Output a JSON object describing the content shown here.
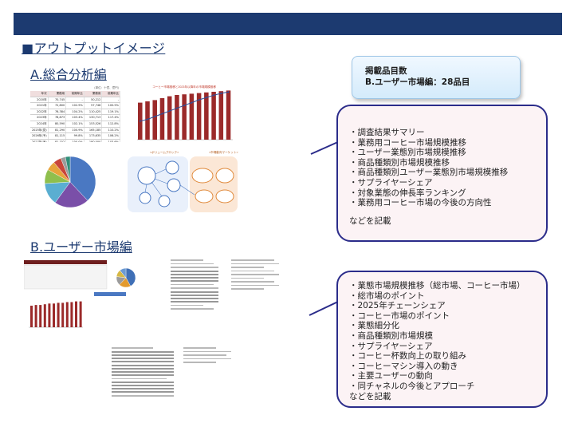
{
  "page": {
    "title": "■アウトプットイメージ",
    "section_a_title": "A.総合分析編",
    "section_b_title": "B.ユーザー市場編"
  },
  "count_box": {
    "line1": "掲載品目数",
    "line2": "B.ユーザー市場編：28品目"
  },
  "callout_a": {
    "items": [
      "・調査結果サマリー",
      "・業務用コーヒー市場規模推移",
      "・ユーザー業態別市場規模推移",
      "・商品種類別市場規模推移",
      "・商品種類別ユーザー業態別市場規模推移",
      "・サプライヤーシェア",
      "・対象業態の伸長率ランキング",
      "・業務用コーヒー市場の今後の方向性"
    ],
    "note": "などを記載"
  },
  "callout_b": {
    "items": [
      "・業態市場規模推移（総市場、コーヒー市場）",
      "・総市場のポイント",
      "・2025年チェーンシェア",
      "・コーヒー市場のポイント",
      "・業態細分化",
      "・商品種類別市場規模",
      "・サプライヤーシェア",
      "・コーヒー杯数向上の取り組み",
      "・コーヒーマシン導入の動き",
      "・主要ユーザーの動向",
      "・同チャネルの今後とアプローチ"
    ],
    "note": "などを記載"
  },
  "thumbnails": {
    "table_unit": "(単位：十億、億円)",
    "table_head": [
      "年次",
      "業務用",
      "前期年比",
      "業務用",
      "前期年比"
    ],
    "table_rows": [
      [
        "2020年",
        "70,745",
        "-",
        "50,212",
        "-"
      ],
      [
        "2021年",
        "72,800",
        "102.9%",
        "57,748",
        "100.5%"
      ],
      [
        "2022年",
        "76,384",
        "104.2%",
        "110,425",
        "119.1%"
      ],
      [
        "2023年",
        "78,873",
        "103.4%",
        "130,713",
        "117.4%"
      ],
      [
        "2024年",
        "80,590",
        "102.1%",
        "153,526",
        "112.8%"
      ],
      [
        "2025年(見)",
        "81,290",
        "100.9%",
        "165,185",
        "110.2%"
      ],
      [
        "2026年(予)",
        "81,115",
        "99.8%",
        "173,635",
        "106.2%"
      ],
      [
        "2027年(予)",
        "81,152",
        "100.0%",
        "180,000",
        "103.6%"
      ]
    ],
    "bar_chart_title": "コーヒー市場推移と2023年以降年の市場規模推移",
    "bar_values": [
      58,
      60,
      62,
      65,
      68,
      70,
      71,
      72,
      73,
      74,
      75,
      76,
      77
    ],
    "line_values": [
      40,
      44,
      50,
      56,
      62,
      68,
      74,
      80,
      86,
      91,
      96,
      100,
      103
    ],
    "pie_values": [
      38,
      22,
      14,
      9,
      6,
      5,
      3,
      3
    ],
    "pie_colors": [
      "#4a78c2",
      "#7a4fa8",
      "#5aaed1",
      "#8fbf4d",
      "#e7a43b",
      "#c9453a",
      "#9c9c9c",
      "#2f8f7a"
    ],
    "diagram_left_label": "<ボリュームブロック>",
    "diagram_right_label": "<市場動向マーケット>",
    "b_bar_values": [
      30,
      31,
      31,
      32,
      33,
      33,
      34,
      34,
      35,
      35,
      36,
      36
    ],
    "b_pie_values": [
      42,
      20,
      15,
      12,
      11
    ],
    "b_pie_colors": [
      "#3f6fb6",
      "#e39a2d",
      "#9b9b9b",
      "#d6b845",
      "#6b9ad4"
    ]
  }
}
